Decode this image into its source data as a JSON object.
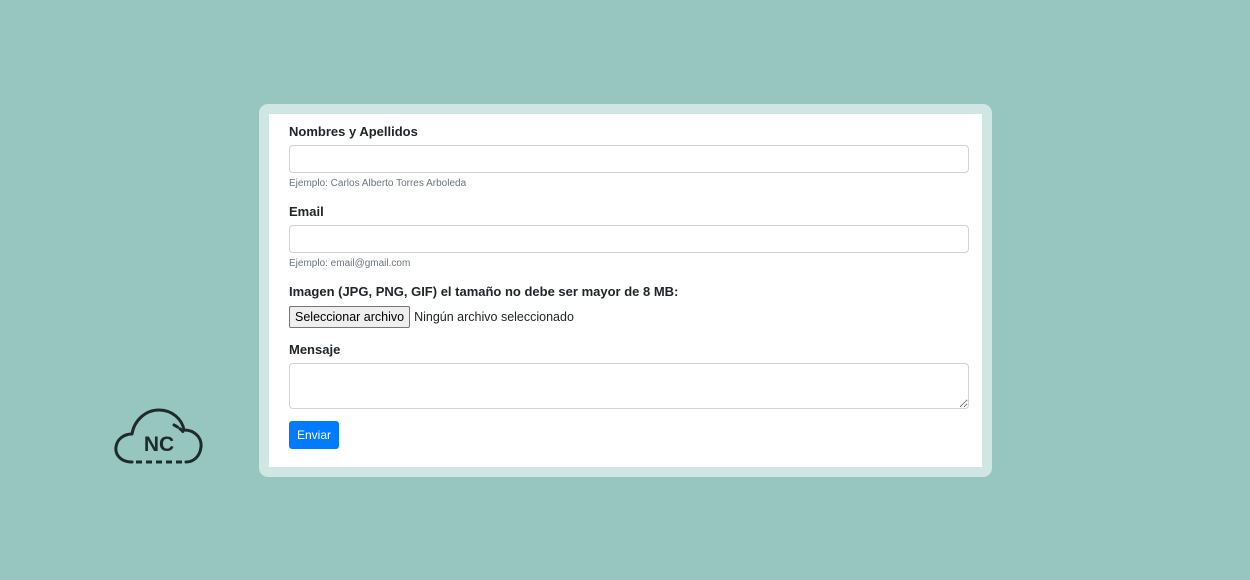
{
  "form": {
    "name_label": "Nombres y Apellidos",
    "name_value": "",
    "name_hint": "Ejemplo: Carlos Alberto Torres Arboleda",
    "email_label": "Email",
    "email_value": "",
    "email_hint": "Ejemplo: email@gmail.com",
    "image_label": "Imagen (JPG, PNG, GIF) el tamaño no debe ser mayor de 8 MB:",
    "file_button_label": "Seleccionar archivo",
    "file_status": "Ningún archivo seleccionado",
    "message_label": "Mensaje",
    "message_value": "",
    "submit_label": "Enviar"
  },
  "logo": {
    "text": "NC",
    "icon": "cloud-icon"
  },
  "colors": {
    "background": "#96c6bf",
    "frame": "#cfe6e2",
    "card": "#ffffff",
    "accent": "#007bff"
  }
}
